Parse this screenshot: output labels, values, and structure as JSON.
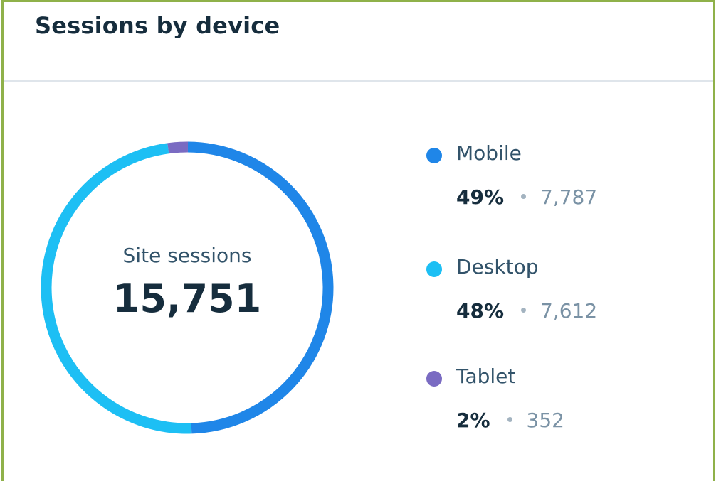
{
  "card": {
    "title": "Sessions by device"
  },
  "center": {
    "label": "Site sessions",
    "value": "15,751"
  },
  "legend": [
    {
      "name": "Mobile",
      "percent": "49%",
      "count": "7,787",
      "color": "#1f86e8"
    },
    {
      "name": "Desktop",
      "percent": "48%",
      "count": "7,612",
      "color": "#1dbff4"
    },
    {
      "name": "Tablet",
      "percent": "2%",
      "count": "352",
      "color": "#7a6bc2"
    }
  ],
  "chart_data": {
    "type": "pie",
    "categories": [
      "Mobile",
      "Desktop",
      "Tablet"
    ],
    "values": [
      7787,
      7612,
      352
    ],
    "percentages": [
      49,
      48,
      2
    ],
    "colors": [
      "#1f86e8",
      "#1dbff4",
      "#7a6bc2"
    ],
    "total": 15751,
    "total_label": "Site sessions",
    "title": "Sessions by device",
    "legend_placement": "right"
  }
}
